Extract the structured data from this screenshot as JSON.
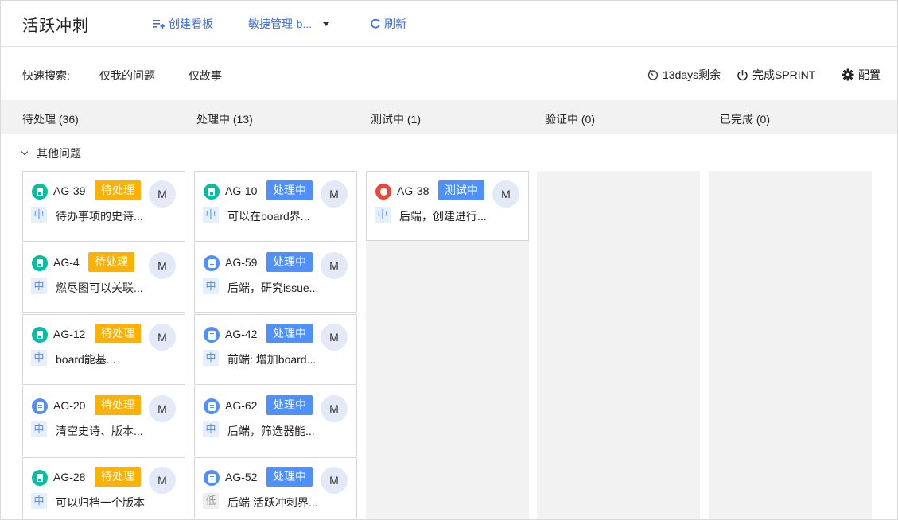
{
  "header": {
    "title": "活跃冲刺",
    "create_board": "创建看板",
    "board_select": "敏捷管理-b...",
    "refresh": "刷新"
  },
  "quick_search": {
    "label": "快速搜索:",
    "filters": [
      "仅我的问题",
      "仅故事"
    ],
    "remaining": "13days剩余",
    "complete_sprint": "完成SPRINT",
    "settings": "配置"
  },
  "columns": [
    {
      "label": "待处理 (36)"
    },
    {
      "label": "处理中 (13)"
    },
    {
      "label": "测试中 (1)"
    },
    {
      "label": "验证中 (0)"
    },
    {
      "label": "已完成 (0)"
    }
  ],
  "group": {
    "label": "其他问题"
  },
  "cards": {
    "todo": [
      {
        "key": "AG-39",
        "type": "story",
        "status": "待处理",
        "priority": "中",
        "summary": "待办事项的史诗...",
        "assignee": "M"
      },
      {
        "key": "AG-4",
        "type": "story",
        "status": "待处理",
        "priority": "中",
        "summary": "燃尽图可以关联...",
        "assignee": "M"
      },
      {
        "key": "AG-12",
        "type": "story",
        "status": "待处理",
        "priority": "中",
        "summary": "board能基...",
        "assignee": "M"
      },
      {
        "key": "AG-20",
        "type": "task",
        "status": "待处理",
        "priority": "中",
        "summary": "清空史诗、版本...",
        "assignee": "M"
      },
      {
        "key": "AG-28",
        "type": "story",
        "status": "待处理",
        "priority": "中",
        "summary": "可以归档一个版本",
        "assignee": "M"
      }
    ],
    "doing": [
      {
        "key": "AG-10",
        "type": "story",
        "status": "处理中",
        "priority": "中",
        "summary": "可以在board界...",
        "assignee": "M"
      },
      {
        "key": "AG-59",
        "type": "task",
        "status": "处理中",
        "priority": "中",
        "summary": "后端，研究issue...",
        "assignee": "M"
      },
      {
        "key": "AG-42",
        "type": "task",
        "status": "处理中",
        "priority": "中",
        "summary": "前端: 增加board...",
        "assignee": "M"
      },
      {
        "key": "AG-62",
        "type": "task",
        "status": "处理中",
        "priority": "中",
        "summary": "后端，筛选器能...",
        "assignee": "M"
      },
      {
        "key": "AG-52",
        "type": "task",
        "status": "处理中",
        "priority": "低",
        "summary": "后端 活跃冲刺界...",
        "assignee": "M"
      }
    ],
    "testing": [
      {
        "key": "AG-38",
        "type": "bug",
        "status": "测试中",
        "priority": "中",
        "summary": "后端，创建进行...",
        "assignee": "M"
      }
    ]
  },
  "colors": {
    "accent": "#3f6fd6",
    "todo": "#ffb100",
    "doing": "#4d90fe",
    "story": "#00bfa5",
    "bug": "#f44336"
  }
}
